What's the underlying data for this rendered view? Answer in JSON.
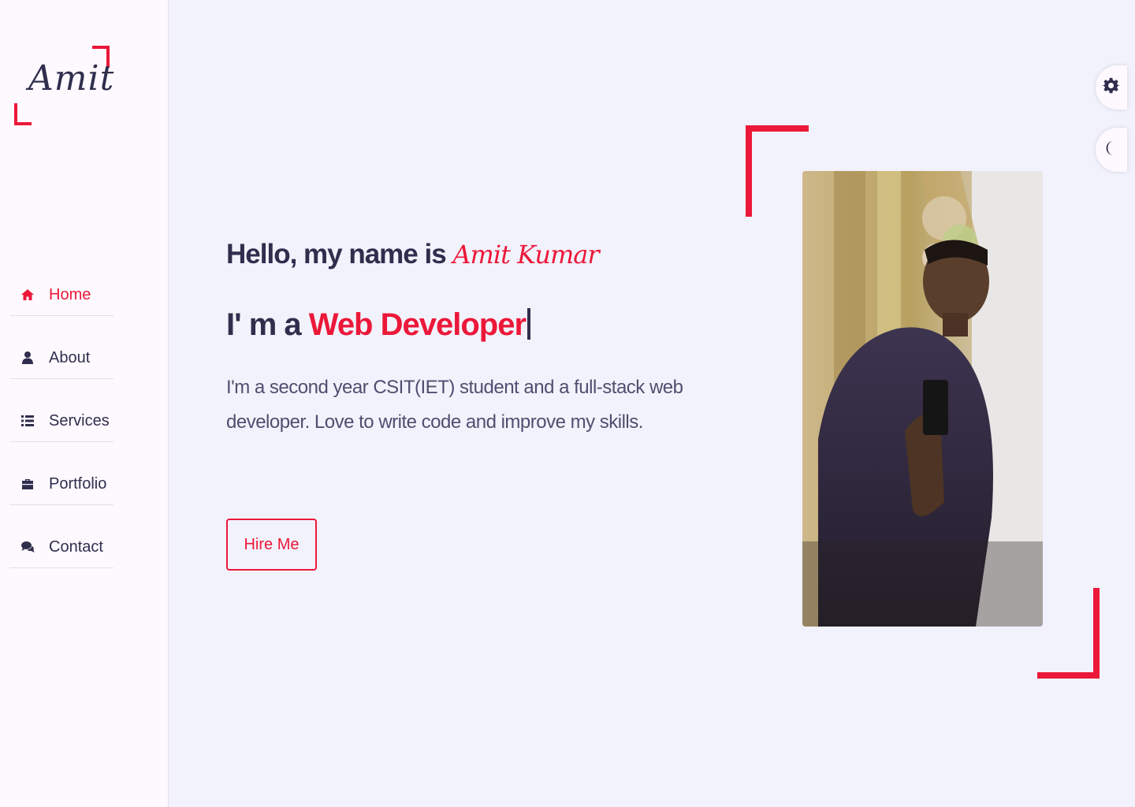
{
  "logo": {
    "text": "Amit"
  },
  "nav": {
    "items": [
      {
        "label": "Home",
        "icon": "home-icon",
        "active": true
      },
      {
        "label": "About",
        "icon": "user-icon",
        "active": false
      },
      {
        "label": "Services",
        "icon": "list-icon",
        "active": false
      },
      {
        "label": "Portfolio",
        "icon": "briefcase-icon",
        "active": false
      },
      {
        "label": "Contact",
        "icon": "chat-icon",
        "active": false
      }
    ]
  },
  "hero": {
    "greeting": "Hello, my name is ",
    "name": "Amit Kumar",
    "role_prefix": "I' m a ",
    "role_typed": "Web Developer",
    "description": "I'm a second year CSIT(IET) student and a full-stack web developer. Love to write code and improve my skills.",
    "cta_label": "Hire Me"
  },
  "controls": {
    "settings_icon": "gear-icon",
    "theme_icon": "moon-icon"
  },
  "colors": {
    "accent": "#ec1839",
    "text_dark": "#302e4d",
    "background": "#f2f2fc",
    "sidebar": "#fdf9ff"
  }
}
